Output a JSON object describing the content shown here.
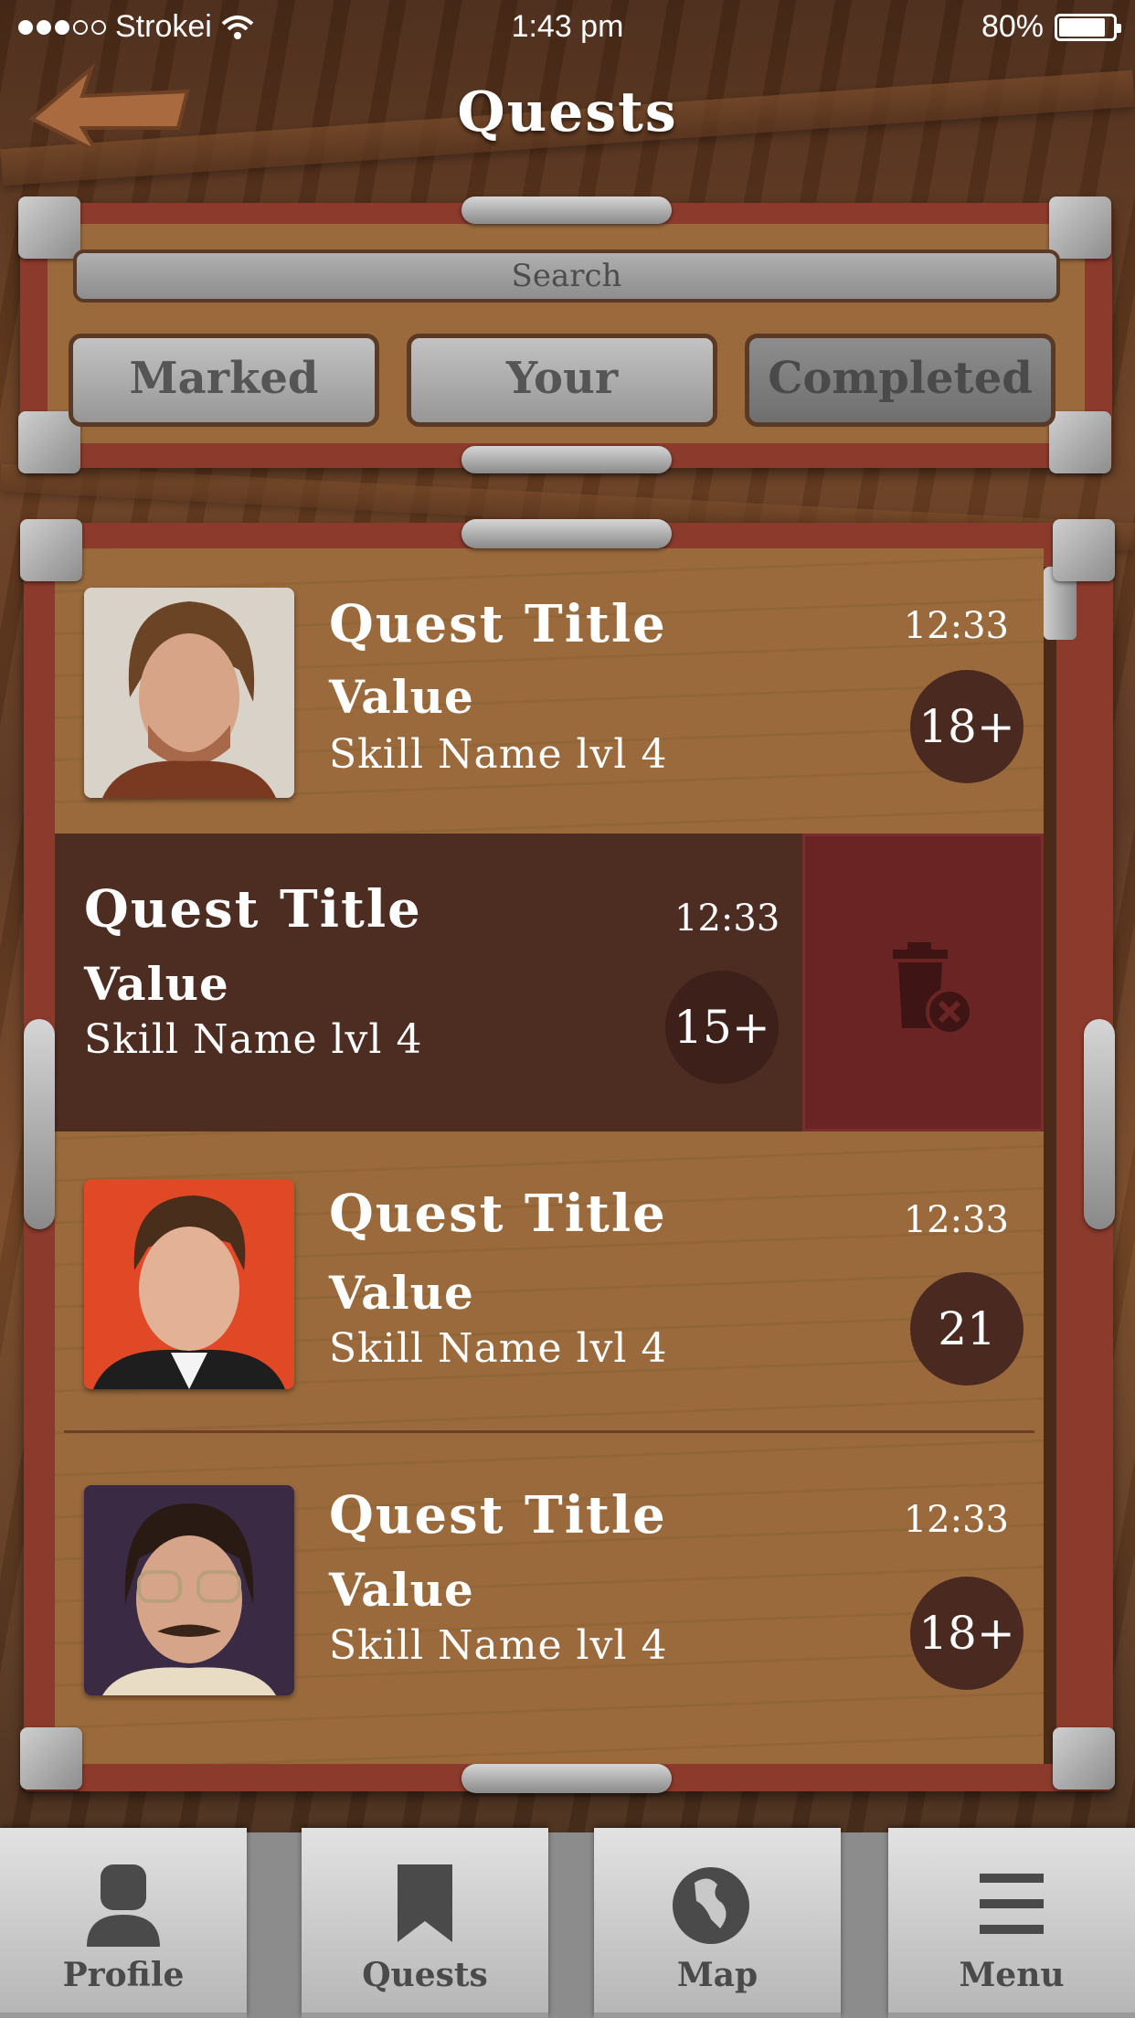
{
  "status_bar": {
    "carrier": "Strokei",
    "time": "1:43 pm",
    "battery": "80%",
    "battery_level": 0.8
  },
  "header": {
    "title": "Quests"
  },
  "search": {
    "placeholder": "Search"
  },
  "filters": {
    "marked": "Marked",
    "your": "Your",
    "completed": "Completed",
    "active": "completed"
  },
  "quests": [
    {
      "title": "Quest Title",
      "value": "Value",
      "skill": "Skill Name lvl 4",
      "time": "12:33",
      "age": "18+"
    },
    {
      "title": "Quest Title",
      "value": "Value",
      "skill": "Skill Name lvl 4",
      "time": "12:33",
      "age": "15+"
    },
    {
      "title": "Quest Title",
      "value": "Value",
      "skill": "Skill Name lvl 4",
      "time": "12:33",
      "age": "21"
    },
    {
      "title": "Quest Title",
      "value": "Value",
      "skill": "Skill Name lvl 4",
      "time": "12:33",
      "age": "18+"
    }
  ],
  "tabs": [
    {
      "label": "Profile",
      "icon": "person-icon"
    },
    {
      "label": "Quests",
      "icon": "bookmark-icon"
    },
    {
      "label": "Map",
      "icon": "globe-icon"
    },
    {
      "label": "Menu",
      "icon": "hamburger-icon"
    }
  ],
  "colors": {
    "frame": "#8b3a2c",
    "wood": "#9a6a3c",
    "dark_row": "#4d2c22",
    "delete": "#6b2424",
    "badge": "#4a2a20"
  }
}
